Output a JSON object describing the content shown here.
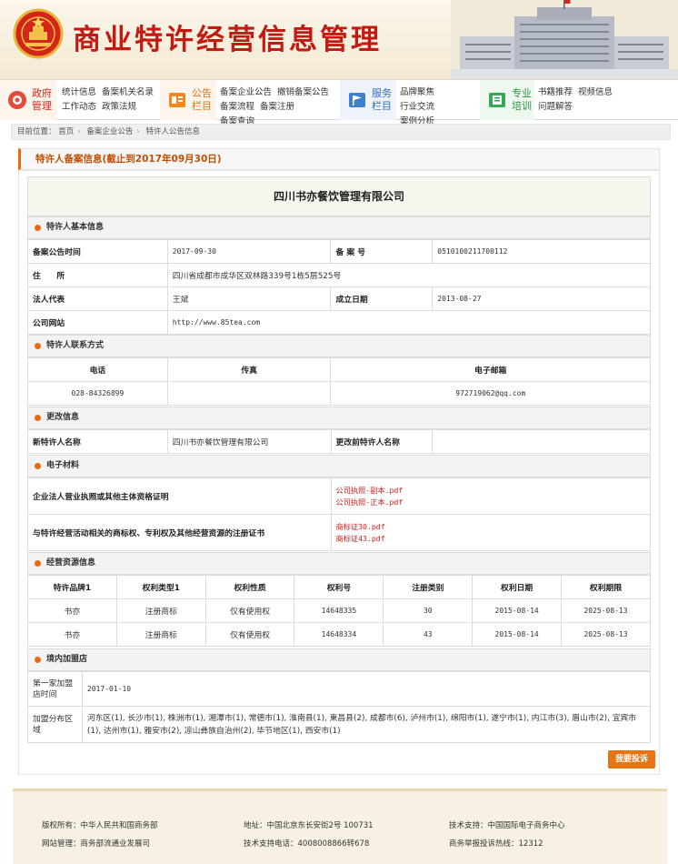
{
  "header": {
    "site_title": "商业特许经营信息管理"
  },
  "nav": {
    "groups": [
      {
        "category": "政府管理",
        "cat_line1": "政府",
        "cat_line2": "管理",
        "links": [
          "统计信息",
          "备案机关名录",
          "工作动态",
          "政策法规"
        ]
      },
      {
        "category": "公告栏目",
        "cat_line1": "公告",
        "cat_line2": "栏目",
        "links": [
          "备案企业公告",
          "撤销备案公告",
          "备案流程",
          "备案注册",
          "备案查询"
        ]
      },
      {
        "category": "服务栏目",
        "cat_line1": "服务",
        "cat_line2": "栏目",
        "links": [
          "品牌聚焦",
          "行业交流",
          "案例分析"
        ]
      },
      {
        "category": "专业培训",
        "cat_line1": "专业",
        "cat_line2": "培训",
        "links": [
          "书籍推荐",
          "视频信息",
          "问题解答"
        ]
      }
    ]
  },
  "breadcrumb": {
    "prefix": "目前位置：",
    "items": [
      "首页",
      "备案企业公告",
      "特许人公告信息"
    ]
  },
  "section_title": "特许人备案信息(截止到2017年09月30日)",
  "company_name": "四川书亦餐饮管理有限公司",
  "basic": {
    "heading": "特许人基本信息",
    "announce_time_label": "备案公告时间",
    "announce_time": "2017-09-30",
    "record_no_label": "备 案 号",
    "record_no": "0510100211700112",
    "address_label": "住　　所",
    "address": "四川省成都市成华区双林路339号1栋5层525号",
    "legal_rep_label": "法人代表",
    "legal_rep": "王斌",
    "found_date_label": "成立日期",
    "found_date": "2013-08-27",
    "website_label": "公司网站",
    "website": "http://www.85tea.com"
  },
  "contact": {
    "heading": "特许人联系方式",
    "phone_label": "电话",
    "fax_label": "传真",
    "email_label": "电子邮箱",
    "phone": "028-84326899",
    "fax": "",
    "email": "972719062@qq.com"
  },
  "change": {
    "heading": "更改信息",
    "new_name_label": "新特许人名称",
    "new_name": "四川书亦餐饮管理有限公司",
    "old_name_label": "更改前特许人名称",
    "old_name": ""
  },
  "materials": {
    "heading": "电子材料",
    "rows": [
      {
        "label": "企业法人营业执照或其他主体资格证明",
        "files": [
          "公司执照-副本.pdf",
          "公司执照-正本.pdf"
        ]
      },
      {
        "label": "与特许经营活动相关的商标权、专利权及其他经营资源的注册证书",
        "files": [
          "商标证30.pdf",
          "商标证43.pdf"
        ]
      }
    ]
  },
  "resources": {
    "heading": "经营资源信息",
    "columns": [
      "特许品牌1",
      "权利类型1",
      "权利性质",
      "权利号",
      "注册类别",
      "权利日期",
      "权利期限"
    ],
    "rows": [
      [
        "书亦",
        "注册商标",
        "仅有使用权",
        "14648335",
        "30",
        "2015-08-14",
        "2025-08-13"
      ],
      [
        "书亦",
        "注册商标",
        "仅有使用权",
        "14648334",
        "43",
        "2015-08-14",
        "2025-08-13"
      ]
    ]
  },
  "domestic": {
    "heading": "境内加盟店",
    "first_store_label": "第一家加盟店时间",
    "first_store_date": "2017-01-10",
    "distribution_label": "加盟分布区域",
    "distribution": "河东区(1), 长沙市(1), 株洲市(1), 湘潭市(1), 常德市(1), 淮南县(1), 東昌县(2), 成都市(6), 泸州市(1), 绵阳市(1), 遂宁市(1), 内江市(3), 眉山市(2), 宜宾市(1), 达州市(1), 雅安市(2), 凉山彝族自治州(2), 毕节地区(1), 西安市(1)"
  },
  "complain_button": "我要投诉",
  "footer": {
    "copyright": "版权所有：中华人民共和国商务部",
    "site_manage": "网站管理：商务部流通业发展司",
    "address": "地址：中国北京东长安街2号  100731",
    "tech_phone": "技术支持电话：4008008866转678",
    "tech_support": "技术支持：中国国际电子商务中心",
    "hotline": "商务举报投诉热线：12312"
  },
  "colors": {
    "title_red": "#c41a12",
    "accent_orange": "#e86b13",
    "file_red": "#d31c1c"
  }
}
